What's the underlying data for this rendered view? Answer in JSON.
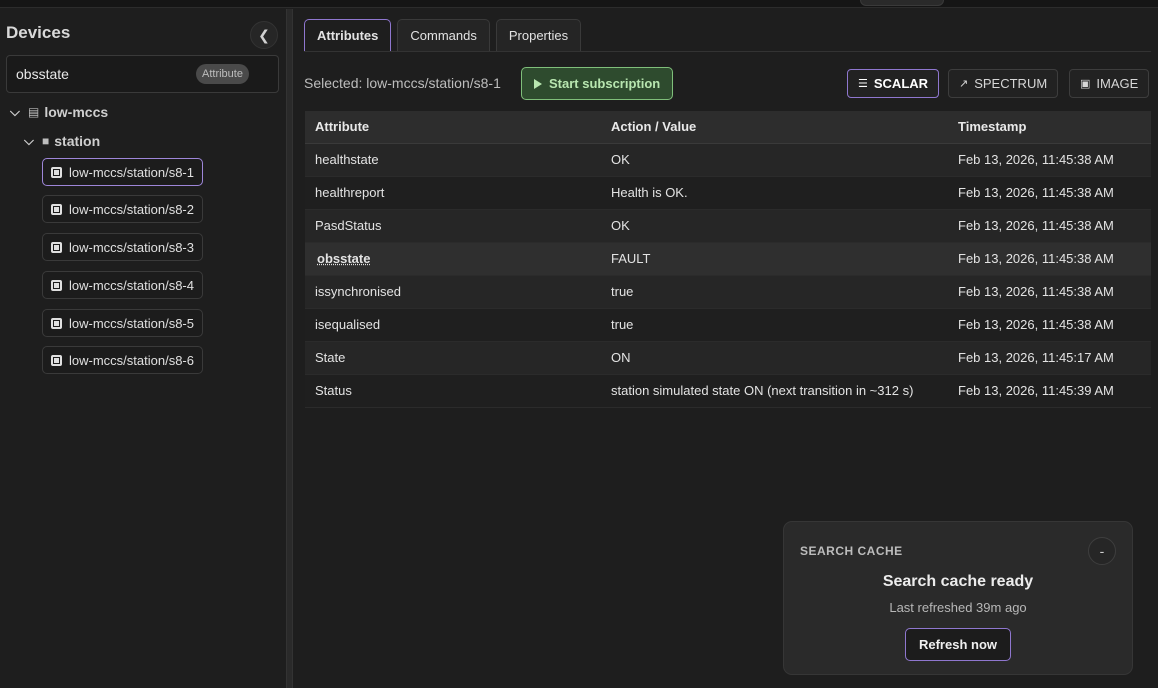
{
  "sidebar": {
    "title": "Devices",
    "collapse_icon": "chevron-left-icon",
    "search": {
      "value": "obsstate",
      "chip": "Attribute"
    },
    "tree": {
      "root": "low-mccs",
      "folder": "station",
      "devices": [
        "low-mccs/station/s8-1",
        "low-mccs/station/s8-2",
        "low-mccs/station/s8-3",
        "low-mccs/station/s8-4",
        "low-mccs/station/s8-5",
        "low-mccs/station/s8-6"
      ]
    }
  },
  "main": {
    "tabs": [
      {
        "label": "Attributes",
        "active": true
      },
      {
        "label": "Commands",
        "active": false
      },
      {
        "label": "Properties",
        "active": false
      }
    ],
    "selected_label": "Selected: low-mccs/station/s8-1",
    "subscription_button": "Start subscription",
    "modes": [
      {
        "label": "SCALAR",
        "icon": "list-icon",
        "active": true
      },
      {
        "label": "SPECTRUM",
        "icon": "line-chart-icon",
        "active": false
      },
      {
        "label": "IMAGE",
        "icon": "image-icon",
        "active": false
      }
    ],
    "table": {
      "headers": [
        "Attribute",
        "Action / Value",
        "Timestamp"
      ],
      "rows": [
        {
          "attribute": "healthstate",
          "value": "OK",
          "timestamp": "Feb 13, 2026, 11:45:38 AM"
        },
        {
          "attribute": "healthreport",
          "value": "Health is OK.",
          "timestamp": "Feb 13, 2026, 11:45:38 AM"
        },
        {
          "attribute": "PasdStatus",
          "value": "OK",
          "timestamp": "Feb 13, 2026, 11:45:38 AM"
        },
        {
          "attribute": "obsstate",
          "value": "FAULT",
          "timestamp": "Feb 13, 2026, 11:45:38 AM"
        },
        {
          "attribute": "issynchronised",
          "value": "true",
          "timestamp": "Feb 13, 2026, 11:45:38 AM"
        },
        {
          "attribute": "isequalised",
          "value": "true",
          "timestamp": "Feb 13, 2026, 11:45:38 AM"
        },
        {
          "attribute": "State",
          "value": "ON",
          "timestamp": "Feb 13, 2026, 11:45:17 AM"
        },
        {
          "attribute": "Status",
          "value": "station simulated state ON (next transition in ~312 s)",
          "timestamp": "Feb 13, 2026, 11:45:39 AM"
        }
      ]
    }
  },
  "search_cache": {
    "heading": "SEARCH CACHE",
    "minimize_label": "-",
    "title": "Search cache ready",
    "subtitle": "Last refreshed 39m ago",
    "button": "Refresh now"
  },
  "colors": {
    "accent": "#8f77cf",
    "success": "#7fbf7a",
    "background": "#1e1e1e"
  }
}
